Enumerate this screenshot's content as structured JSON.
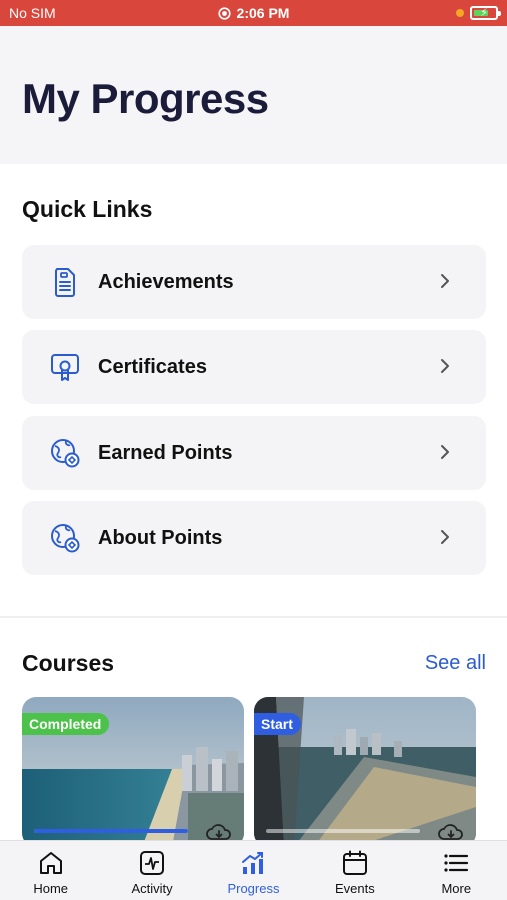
{
  "status_bar": {
    "carrier": "No SIM",
    "time": "2:06 PM"
  },
  "page": {
    "title": "My Progress"
  },
  "quick_links": {
    "title": "Quick Links",
    "items": [
      {
        "label": "Achievements",
        "icon": "document-icon"
      },
      {
        "label": "Certificates",
        "icon": "certificate-icon"
      },
      {
        "label": "Earned Points",
        "icon": "globe-points-icon"
      },
      {
        "label": "About Points",
        "icon": "globe-points-icon"
      }
    ]
  },
  "courses": {
    "title": "Courses",
    "see_all": "See all",
    "cards": [
      {
        "badge": "Completed",
        "badge_color": "#4cc24a",
        "progress": 1.0
      },
      {
        "badge": "Start",
        "badge_color": "#2f5fe0",
        "progress": 0.0
      }
    ]
  },
  "tab_bar": {
    "tabs": [
      {
        "label": "Home",
        "icon": "home-icon",
        "active": false
      },
      {
        "label": "Activity",
        "icon": "activity-icon",
        "active": false
      },
      {
        "label": "Progress",
        "icon": "progress-chart-icon",
        "active": true
      },
      {
        "label": "Events",
        "icon": "calendar-icon",
        "active": false
      },
      {
        "label": "More",
        "icon": "menu-icon",
        "active": false
      }
    ]
  },
  "colors": {
    "accent": "#2f5fe0",
    "status_bar": "#d9463b",
    "icon_blue": "#2a5ccf"
  }
}
